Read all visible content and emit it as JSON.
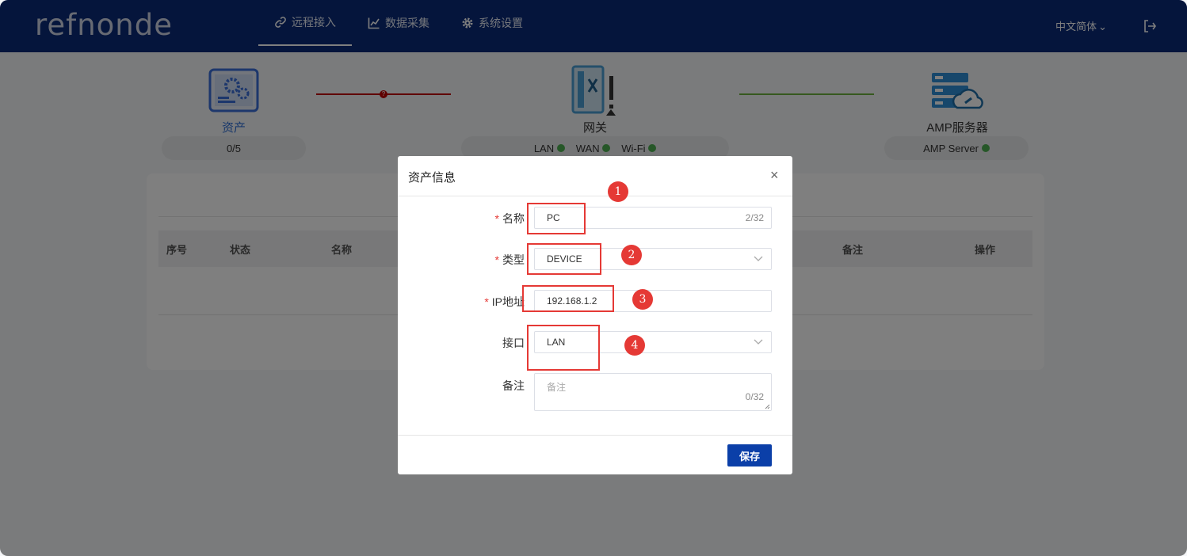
{
  "header": {
    "logo": "refnonde",
    "nav": [
      {
        "label": "远程接入",
        "icon": "link-icon",
        "active": true
      },
      {
        "label": "数据采集",
        "icon": "chart-icon",
        "active": false
      },
      {
        "label": "系统设置",
        "icon": "gear-icon",
        "active": false
      }
    ],
    "language": "中文简体",
    "logout_icon": "logout-icon"
  },
  "topology": {
    "asset": {
      "label": "资产",
      "count": "0/5",
      "icon": "server-gear-icon"
    },
    "gateway": {
      "label": "网关",
      "ports": [
        "LAN",
        "WAN",
        "Wi-Fi"
      ],
      "icon": "gateway-device-icon"
    },
    "amp": {
      "label": "AMP服务器",
      "status": "AMP Server",
      "icon": "cloud-server-icon"
    },
    "colors": {
      "asset_link": "#c00000",
      "amp_link": "#6db33f",
      "ok": "#4caf50"
    }
  },
  "table": {
    "columns": [
      "序号",
      "状态",
      "名称",
      "备注",
      "操作"
    ]
  },
  "modal": {
    "title": "资产信息",
    "fields": {
      "name": {
        "label": "名称",
        "value": "PC",
        "counter": "2/32",
        "required": true
      },
      "type": {
        "label": "类型",
        "value": "DEVICE",
        "required": true
      },
      "ip": {
        "label": "IP地址",
        "value": "192.168.1.2",
        "required": true
      },
      "iface": {
        "label": "接口",
        "value": "LAN",
        "required": false
      },
      "note": {
        "label": "备注",
        "placeholder": "备注",
        "counter": "0/32",
        "required": false
      }
    },
    "save_label": "保存",
    "close_symbol": "×"
  },
  "annotations": [
    "1",
    "2",
    "3",
    "4"
  ]
}
